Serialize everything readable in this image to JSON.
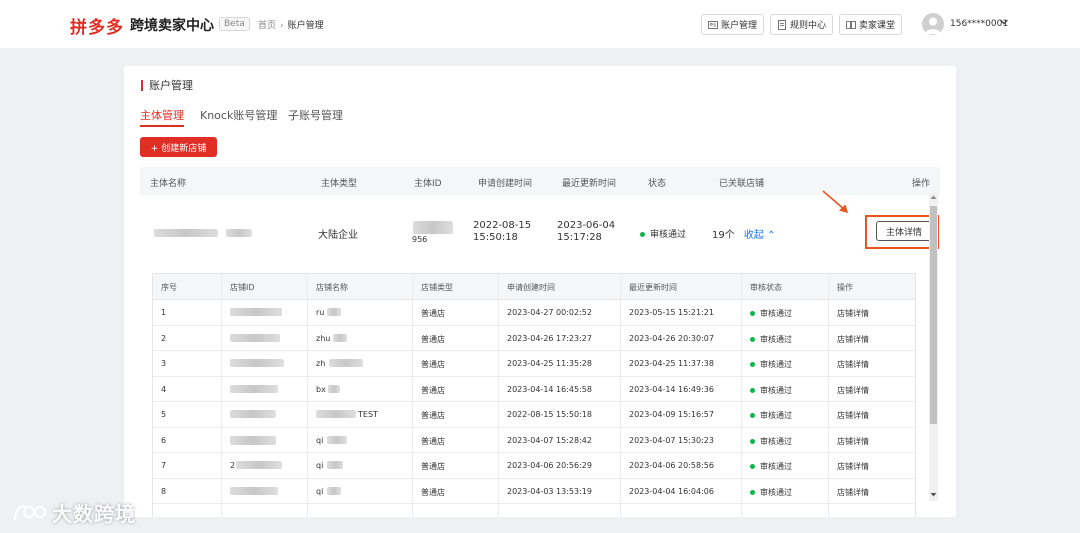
{
  "header": {
    "logo": "拼多多",
    "title": "跨境卖家中心",
    "beta": "Beta",
    "breadcrumb": [
      "首页",
      "账户管理"
    ],
    "buttons": [
      {
        "label": "账户管理",
        "icon": "id-card-icon"
      },
      {
        "label": "规则中心",
        "icon": "document-icon"
      },
      {
        "label": "卖家课堂",
        "icon": "book-icon"
      }
    ],
    "user": {
      "phone": "156****0001"
    }
  },
  "page": {
    "title": "账户管理",
    "tabs": [
      {
        "label": "主体管理",
        "active": true
      },
      {
        "label": "Knock账号管理",
        "active": false
      },
      {
        "label": "子账号管理",
        "active": false
      }
    ],
    "create_button": "+ 创建新店铺"
  },
  "main_table": {
    "columns": [
      "主体名称",
      "主体类型",
      "主体ID",
      "申请创建时间",
      "最近更新时间",
      "状态",
      "已关联店铺",
      "操作"
    ],
    "row": {
      "type": "大陆企业",
      "id_suffix": "956",
      "created": [
        "2022-08-15",
        "15:50:18"
      ],
      "updated": [
        "2023-06-04",
        "15:17:28"
      ],
      "status": "审核通过",
      "shops_count": "19个",
      "collapse": "收起",
      "action": "主体详情"
    }
  },
  "shop_table": {
    "columns": [
      "序号",
      "店铺ID",
      "店铺名称",
      "店铺类型",
      "申请创建时间",
      "最近更新时间",
      "审核状态",
      "操作"
    ],
    "rows": [
      {
        "no": "1",
        "id_prefix": "",
        "name": "ru",
        "type": "普通店",
        "created": "2023-04-27 00:02:52",
        "updated": "2023-05-15 15:21:21",
        "status": "审核通过",
        "action": "店铺详情"
      },
      {
        "no": "2",
        "id_prefix": "",
        "name": "zhu",
        "type": "普通店",
        "created": "2023-04-26 17:23:27",
        "updated": "2023-04-26 20:30:07",
        "status": "审核通过",
        "action": "店铺详情"
      },
      {
        "no": "3",
        "id_prefix": "",
        "name": "zh",
        "type": "普通店",
        "created": "2023-04-25 11:35:28",
        "updated": "2023-04-25 11:37:38",
        "status": "审核通过",
        "action": "店铺详情"
      },
      {
        "no": "4",
        "id_prefix": "",
        "name": "bx",
        "type": "普通店",
        "created": "2023-04-14 16:45:58",
        "updated": "2023-04-14 16:49:36",
        "status": "审核通过",
        "action": "店铺详情"
      },
      {
        "no": "5",
        "id_prefix": "",
        "name": "TEST",
        "type": "普通店",
        "created": "2022-08-15 15:50:18",
        "updated": "2023-04-09 15:16:57",
        "status": "审核通过",
        "action": "店铺详情"
      },
      {
        "no": "6",
        "id_prefix": "",
        "name": "qi",
        "type": "普通店",
        "created": "2023-04-07 15:28:42",
        "updated": "2023-04-07 15:30:23",
        "status": "审核通过",
        "action": "店铺详情"
      },
      {
        "no": "7",
        "id_prefix": "2",
        "name": "qi",
        "type": "普通店",
        "created": "2023-04-06 20:56:29",
        "updated": "2023-04-06 20:58:56",
        "status": "审核通过",
        "action": "店铺详情"
      },
      {
        "no": "8",
        "id_prefix": "",
        "name": "qi",
        "type": "普通店",
        "created": "2023-04-03 13:53:19",
        "updated": "2023-04-04 16:04:06",
        "status": "审核通过",
        "action": "店铺详情"
      }
    ]
  },
  "watermark": "大数跨境",
  "colors": {
    "brand": "#e02e24",
    "link": "#1677ff",
    "success": "#13b24c",
    "highlight": "#e8541c"
  }
}
